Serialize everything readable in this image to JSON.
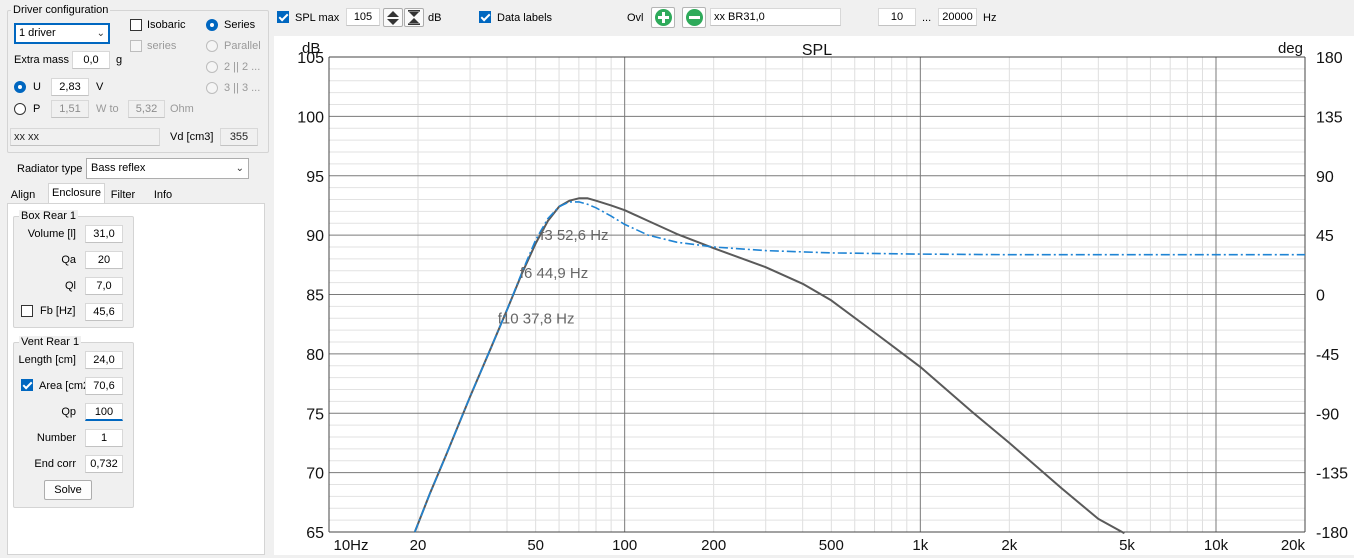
{
  "driver_config": {
    "title": "Driver configuration",
    "driver_count": "1 driver",
    "isobaric": "Isobaric",
    "series_check": "series",
    "series": "Series",
    "parallel": "Parallel",
    "opt_2": "2 || 2 ...",
    "opt_3": "3 || 3 ...",
    "extra_mass_label": "Extra mass",
    "extra_mass_value": "0,0",
    "extra_mass_unit": "g",
    "u_label": "U",
    "u_value": "2,83",
    "u_unit": "V",
    "p_label": "P",
    "p_value": "1,51",
    "w_to": "W to",
    "ohm_value": "5,32",
    "ohm_unit": "Ohm",
    "driver_name": "xx xx",
    "vd_label": "Vd [cm3]",
    "vd_value": "355"
  },
  "radiator": {
    "label": "Radiator type",
    "value": "Bass reflex"
  },
  "tabs": [
    "Align",
    "Enclosure",
    "Filter",
    "Info"
  ],
  "box": {
    "title": "Box Rear 1",
    "volume_label": "Volume [l]",
    "volume": "31,0",
    "qa_label": "Qa",
    "qa": "20",
    "ql_label": "Ql",
    "ql": "7,0",
    "fb_label": "Fb [Hz]",
    "fb": "45,6"
  },
  "vent": {
    "title": "Vent Rear 1",
    "length_label": "Length [cm]",
    "length": "24,0",
    "area_label": "Area [cm2",
    "area": "70,6",
    "qp_label": "Qp",
    "qp": "100",
    "number_label": "Number",
    "number": "1",
    "endcorr_label": "End corr",
    "endcorr": "0,732",
    "solve": "Solve"
  },
  "toolbar": {
    "spl_max_label": "SPL max",
    "spl_max": "105",
    "db": "dB",
    "data_labels": "Data labels",
    "ovl": "Ovl",
    "overlay_name": "xx BR31,0",
    "f_min": "10",
    "ellipsis": "...",
    "f_max": "20000",
    "hz": "Hz"
  },
  "chart_data": {
    "type": "line",
    "title": "SPL",
    "ylabel": "dB",
    "y2label": "deg",
    "x_scale": "log",
    "xlim": [
      10,
      20000
    ],
    "ylim": [
      65,
      105
    ],
    "y2lim": [
      -180,
      180
    ],
    "grid": true,
    "x_ticks": [
      {
        "v": 10,
        "t": "10Hz"
      },
      {
        "v": 20,
        "t": "20"
      },
      {
        "v": 50,
        "t": "50"
      },
      {
        "v": 100,
        "t": "100"
      },
      {
        "v": 200,
        "t": "200"
      },
      {
        "v": 500,
        "t": "500"
      },
      {
        "v": 1000,
        "t": "1k"
      },
      {
        "v": 2000,
        "t": "2k"
      },
      {
        "v": 5000,
        "t": "5k"
      },
      {
        "v": 10000,
        "t": "10k"
      },
      {
        "v": 20000,
        "t": "20k"
      }
    ],
    "y_ticks": [
      65,
      70,
      75,
      80,
      85,
      90,
      95,
      100,
      105
    ],
    "y2_ticks": [
      -180,
      -135,
      -90,
      -45,
      0,
      45,
      90,
      135,
      180
    ],
    "series": [
      {
        "color": "#5a5a5a",
        "style": "solid",
        "points": [
          [
            19.5,
            65
          ],
          [
            22,
            68.3
          ],
          [
            25,
            71.6
          ],
          [
            30,
            76.4
          ],
          [
            35,
            80.3
          ],
          [
            40,
            83.7
          ],
          [
            45,
            86.8
          ],
          [
            50,
            89.3
          ],
          [
            55,
            91.2
          ],
          [
            60,
            92.4
          ],
          [
            65,
            92.9
          ],
          [
            70,
            93.1
          ],
          [
            75,
            93.1
          ],
          [
            80,
            92.9
          ],
          [
            90,
            92.5
          ],
          [
            100,
            92.1
          ],
          [
            120,
            91.2
          ],
          [
            150,
            90.1
          ],
          [
            200,
            88.9
          ],
          [
            300,
            87.3
          ],
          [
            400,
            85.9
          ],
          [
            500,
            84.5
          ],
          [
            700,
            81.8
          ],
          [
            1000,
            78.9
          ],
          [
            1500,
            75.1
          ],
          [
            2000,
            72.5
          ],
          [
            3000,
            68.7
          ],
          [
            4000,
            66.1
          ],
          [
            4900,
            64.9
          ]
        ]
      },
      {
        "color": "#1f84d4",
        "style": "dashdot",
        "points": [
          [
            19.5,
            65
          ],
          [
            22,
            68.3
          ],
          [
            25,
            71.6
          ],
          [
            30,
            76.4
          ],
          [
            35,
            80.3
          ],
          [
            40,
            83.7
          ],
          [
            45,
            86.9
          ],
          [
            50,
            89.6
          ],
          [
            55,
            91.4
          ],
          [
            60,
            92.4
          ],
          [
            65,
            92.8
          ],
          [
            70,
            92.8
          ],
          [
            75,
            92.6
          ],
          [
            80,
            92.3
          ],
          [
            90,
            91.6
          ],
          [
            100,
            90.9
          ],
          [
            120,
            90.0
          ],
          [
            150,
            89.4
          ],
          [
            200,
            89.0
          ],
          [
            300,
            88.7
          ],
          [
            500,
            88.5
          ],
          [
            1000,
            88.4
          ],
          [
            2000,
            88.35
          ],
          [
            5000,
            88.35
          ],
          [
            10000,
            88.35
          ],
          [
            20000,
            88.35
          ]
        ]
      }
    ],
    "annotations": [
      {
        "text": "f3 52,6 Hz",
        "x": 52.6,
        "y": 90.0
      },
      {
        "text": "f6 44,9 Hz",
        "x": 44.9,
        "y": 86.8
      },
      {
        "text": "f10 37,8 Hz",
        "x": 37.8,
        "y": 83.0
      }
    ]
  }
}
